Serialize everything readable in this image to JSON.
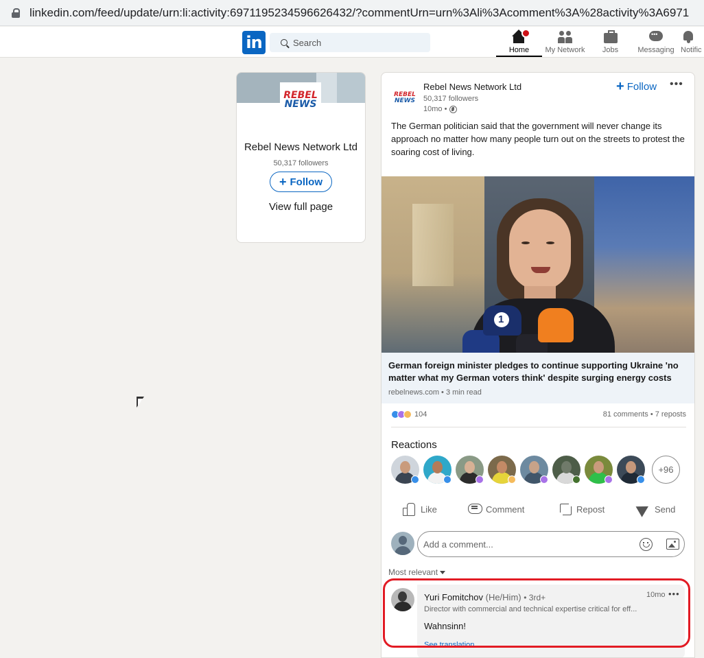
{
  "browser": {
    "url": "linkedin.com/feed/update/urn:li:activity:6971195234596626432/?commentUrn=urn%3Ali%3Acomment%3A%28activity%3A6971"
  },
  "nav": {
    "logo_text": "in",
    "search_placeholder": "Search",
    "items": [
      {
        "label": "Home",
        "icon": "home-icon",
        "active": true
      },
      {
        "label": "My Network",
        "icon": "my-network-icon"
      },
      {
        "label": "Jobs",
        "icon": "jobs-icon"
      },
      {
        "label": "Messaging",
        "icon": "messaging-icon"
      },
      {
        "label": "Notific",
        "icon": "notifications-icon"
      }
    ]
  },
  "company": {
    "logo_line1": "REBEL",
    "logo_line2": "NEWS",
    "name": "Rebel News Network Ltd",
    "followers": "50,317 followers",
    "follow_label": "Follow",
    "view_full_page": "View full page"
  },
  "post": {
    "author": "Rebel News Network Ltd",
    "followers": "50,317 followers",
    "time": "10mo •",
    "follow_label": "Follow",
    "more": "•••",
    "text": "The German politician said that the government will never change its approach no matter how many people turn out on the streets to protest the soaring cost of living.",
    "article": {
      "title": "German foreign minister pledges to continue supporting Ukraine 'no matter what my German voters think' despite surging energy costs",
      "source": "rebelnews.com • 3 min read"
    },
    "reaction_count": "104",
    "comments_reposts": "81 comments • 7 reposts",
    "reactions_title": "Reactions",
    "more_reactors": "+96",
    "colors": {
      "accent": "#0a66c2",
      "highlight": "#e21b24"
    }
  },
  "actions": {
    "like": "Like",
    "comment": "Comment",
    "repost": "Repost",
    "send": "Send"
  },
  "comment_input": {
    "placeholder": "Add a comment..."
  },
  "sort": {
    "label": "Most relevant"
  },
  "comment": {
    "author": "Yuri Fomitchov",
    "pronouns": "(He/Him)",
    "degree": "• 3rd+",
    "headline": "Director with commercial and technical expertise critical for eff...",
    "time": "10mo",
    "more": "•••",
    "text": "Wahnsinn!",
    "see_translation": "See translation"
  }
}
